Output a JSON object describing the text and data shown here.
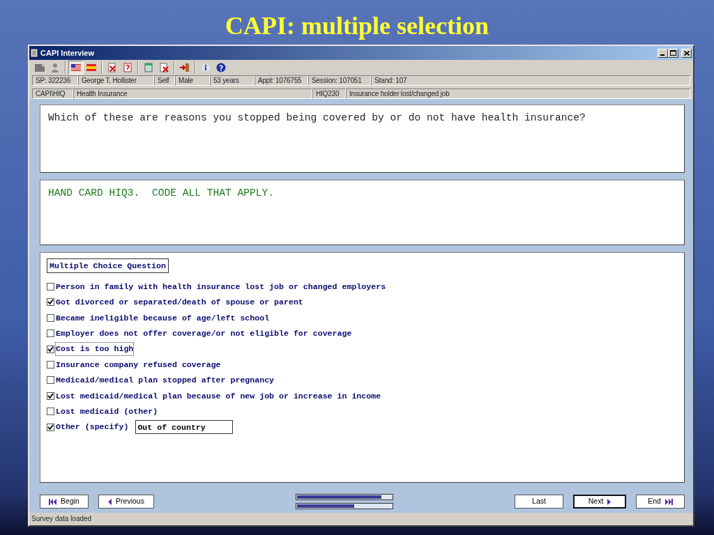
{
  "slide_title": "CAPI: multiple selection",
  "window": {
    "title": "CAPI Interview"
  },
  "toolbar": {
    "language_buttons": [
      {
        "selected": true
      },
      {
        "selected": false
      }
    ]
  },
  "info_row": [
    "SP: 322236",
    "George T. Hollister",
    "Self",
    "Male",
    "53 years",
    "Appt: 1076755",
    "Session: 107051",
    "Stand: 107"
  ],
  "section_row": [
    "CAPI\\HIQ",
    "Health Insurance",
    "HIQ230",
    "Insurance holder lost/changed job"
  ],
  "question": "Which of these are reasons you stopped being covered by or do not have health insurance?",
  "instruction": "HAND CARD HIQ3.  CODE ALL THAT APPLY.",
  "answer_panel": {
    "heading": "Multiple Choice Question",
    "options": [
      {
        "label": "Person in family with health insurance lost job or changed employers",
        "checked": false,
        "focused": false
      },
      {
        "label": "Got divorced or separated/death of spouse or parent",
        "checked": true,
        "focused": false
      },
      {
        "label": "Became ineligible because of age/left school",
        "checked": false,
        "focused": false
      },
      {
        "label": "Employer does not offer coverage/or not eligible for coverage",
        "checked": false,
        "focused": false
      },
      {
        "label": "Cost is too high",
        "checked": true,
        "focused": true
      },
      {
        "label": "Insurance company refused coverage",
        "checked": false,
        "focused": false
      },
      {
        "label": "Medicaid/medical plan stopped after pregnancy",
        "checked": false,
        "focused": false
      },
      {
        "label": "Lost medicaid/medical plan because of new job or increase in income",
        "checked": true,
        "focused": false
      },
      {
        "label": "Lost medicaid (other)",
        "checked": false,
        "focused": false
      },
      {
        "label": "Other (specify)",
        "checked": true,
        "focused": false,
        "specify": "Out of country"
      }
    ]
  },
  "navigation": [
    {
      "label": "Begin",
      "kind": "first",
      "default": false
    },
    {
      "label": "Previous",
      "kind": "prev",
      "default": false
    },
    {
      "kind": "progress",
      "bars": [
        {
          "level": 0.89
        },
        {
          "level": 0.6
        }
      ]
    },
    {
      "label": "Last",
      "kind": "plain",
      "default": false
    },
    {
      "label": "Next",
      "kind": "next",
      "default": true
    },
    {
      "label": "End",
      "kind": "last",
      "default": false
    }
  ],
  "status_bar": "Survey data loaded"
}
